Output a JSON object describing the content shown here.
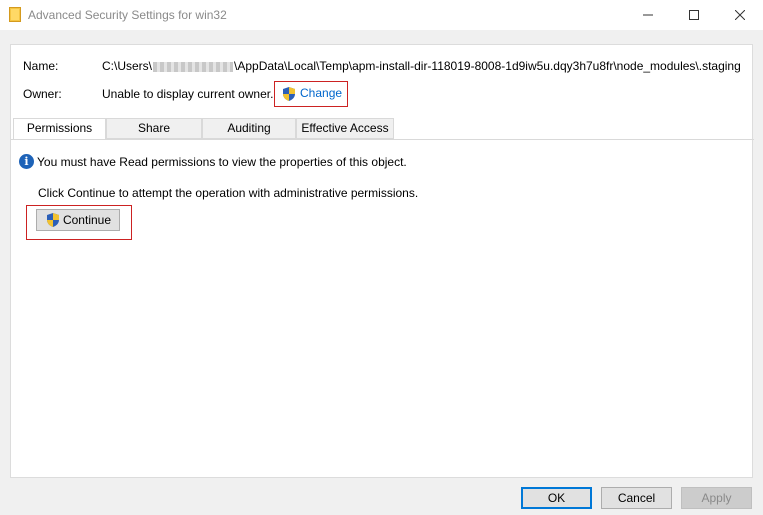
{
  "window": {
    "title": "Advanced Security Settings for win32",
    "icon": "folder-icon",
    "controls": [
      "minimize-icon",
      "maximize-icon",
      "close-icon"
    ]
  },
  "details": {
    "name_label": "Name:",
    "name_prefix": "C:\\Users\\",
    "name_suffix": "\\AppData\\Local\\Temp\\apm-install-dir-118019-8008-1d9iw5u.dqy3h7u8fr\\node_modules\\.staging",
    "owner_label": "Owner:",
    "owner_value": "Unable to display current owner.",
    "change_label": "Change"
  },
  "tabs": [
    {
      "label": "Permissions",
      "active": true
    },
    {
      "label": "Share",
      "active": false
    },
    {
      "label": "Auditing",
      "active": false
    },
    {
      "label": "Effective Access",
      "active": false
    }
  ],
  "message": {
    "info": "You must have Read permissions to view the properties of this object.",
    "instruction": "Click Continue to attempt the operation with administrative permissions.",
    "continue_label": "Continue"
  },
  "buttons": {
    "ok": "OK",
    "cancel": "Cancel",
    "apply": "Apply"
  },
  "colors": {
    "highlight_border": "#cc2222",
    "link": "#0066cc",
    "info_icon": "#1e63b8"
  }
}
